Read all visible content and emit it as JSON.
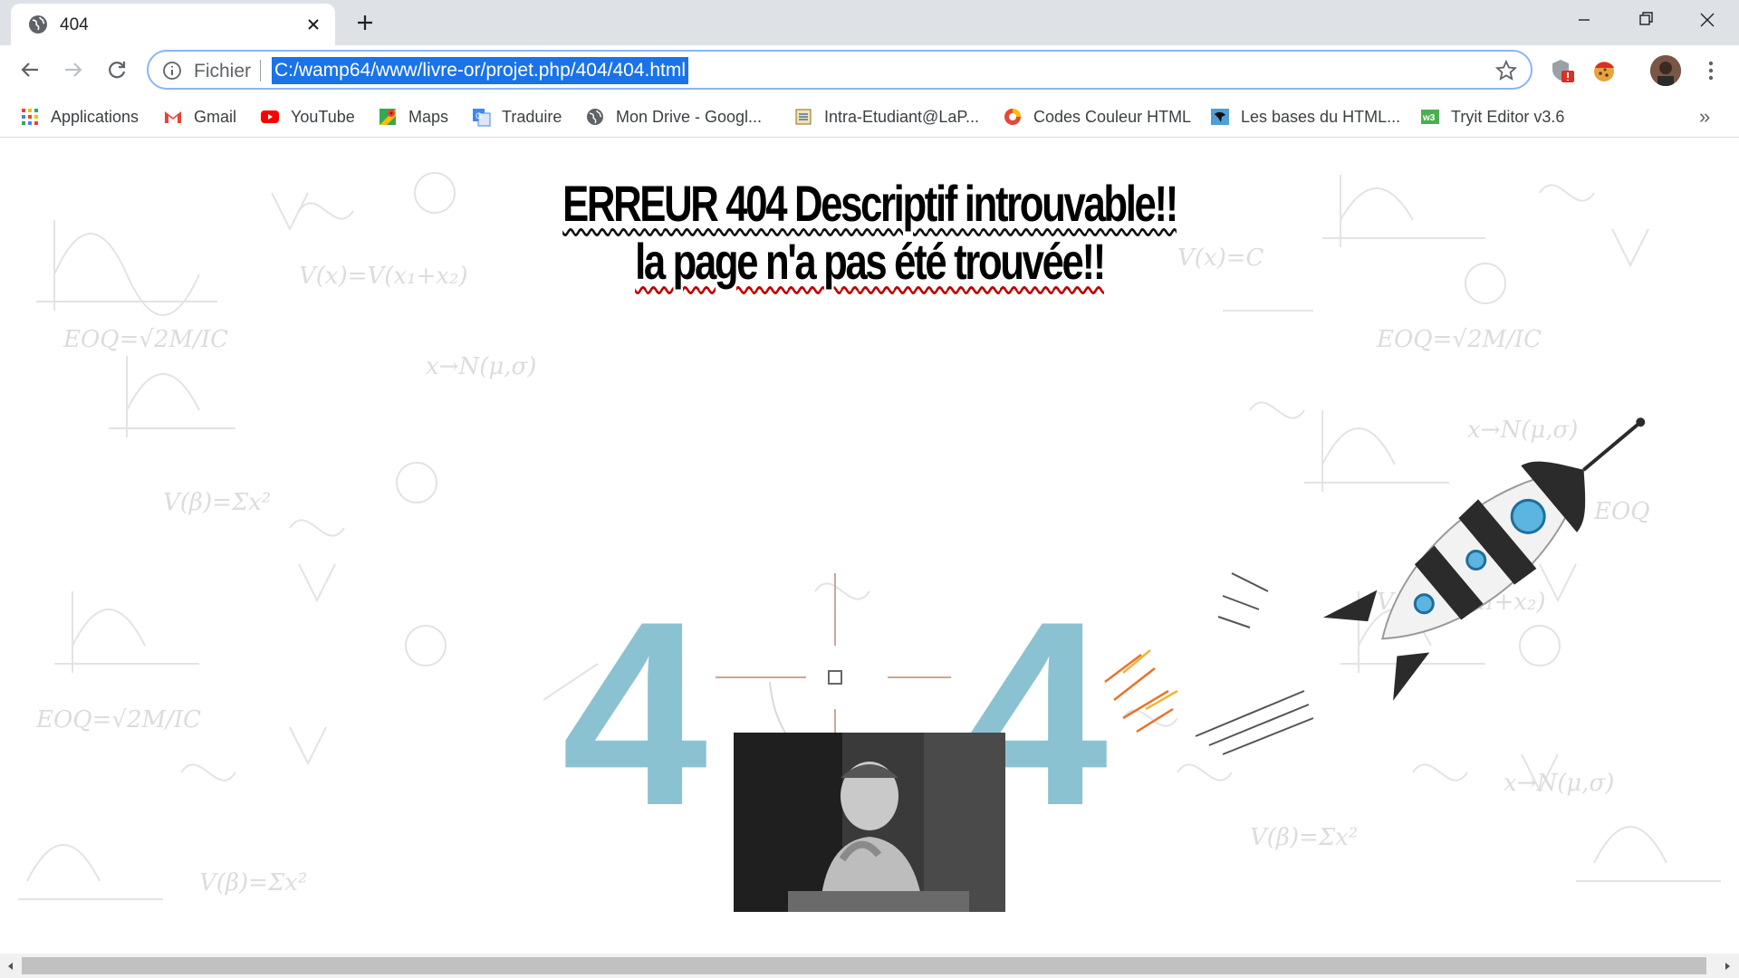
{
  "browser": {
    "tab": {
      "title": "404",
      "favicon": "globe-icon",
      "close_icon": "close-icon"
    },
    "new_tab_icon": "plus-icon",
    "window_controls": [
      "minimize-icon",
      "restore-icon",
      "close-icon"
    ],
    "toolbar": {
      "back_icon": "arrow-left-icon",
      "forward_icon": "arrow-right-icon",
      "reload_icon": "reload-icon",
      "omnibox": {
        "security_icon": "info-icon",
        "scheme_label": "Fichier",
        "url": "C:/wamp64/www/livre-or/projet.php/404/404.html",
        "bookmark_icon": "star-icon"
      },
      "extensions": [
        "shield-alert-icon",
        "cookie-icon"
      ],
      "profile_icon": "avatar",
      "menu_icon": "more-vert-icon"
    },
    "bookmarks": [
      {
        "label": "Applications",
        "icon": "apps-grid-icon"
      },
      {
        "label": "Gmail",
        "icon": "gmail-icon"
      },
      {
        "label": "YouTube",
        "icon": "youtube-icon"
      },
      {
        "label": "Maps",
        "icon": "maps-icon"
      },
      {
        "label": "Traduire",
        "icon": "translate-icon"
      },
      {
        "label": "Mon Drive - Googl...",
        "icon": "globe-icon"
      },
      {
        "label": "Intra-Etudiant@LaP...",
        "icon": "document-icon"
      },
      {
        "label": "Codes Couleur HTML",
        "icon": "color-wheel-icon"
      },
      {
        "label": "Les bases du HTML...",
        "icon": "badge-icon"
      },
      {
        "label": "Tryit Editor v3.6",
        "icon": "w3-icon"
      }
    ],
    "bookmarks_overflow": "»"
  },
  "page": {
    "headline_line1": "ERREUR 404 Descriptif introuvable!!",
    "headline_line2": "la page n'a pas été trouvée!!",
    "art": {
      "digit_left": "4",
      "digit_right": "4",
      "rocket": "rocket-illustration",
      "color_digits": "#8bc2d2"
    },
    "photo": "sad-child-photo"
  },
  "colors": {
    "accent": "#1a73e8",
    "tabstrip": "#dee1e6",
    "digits": "#8bc2d2"
  }
}
